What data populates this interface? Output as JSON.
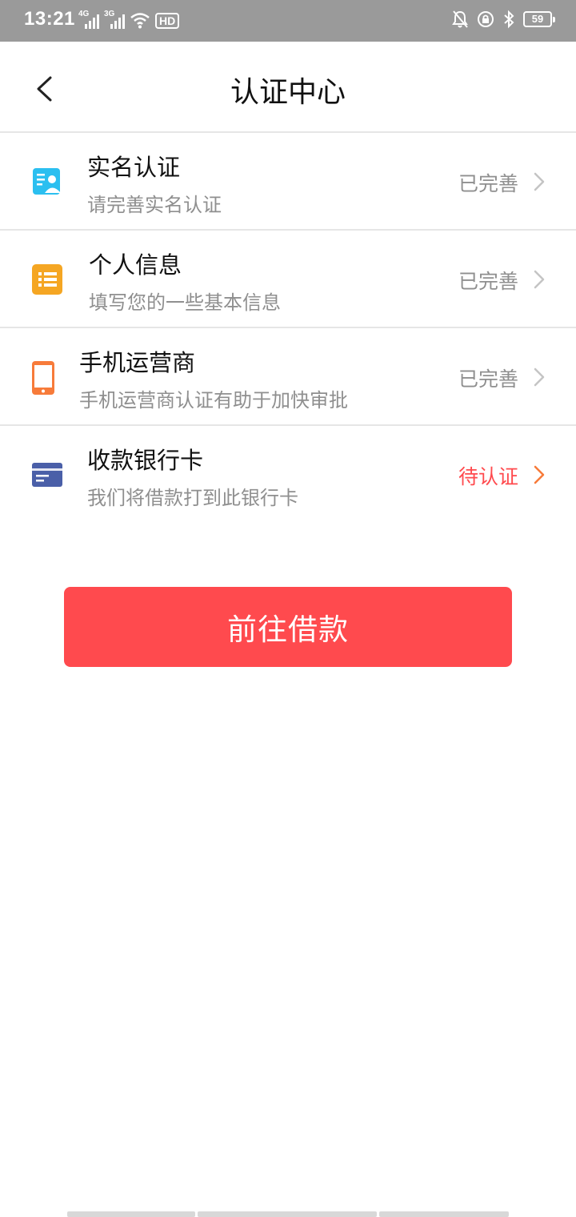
{
  "status_bar": {
    "time": "13:21",
    "signal1_label": "4G",
    "signal2_label": "3G",
    "hd_label": "HD",
    "battery": "59"
  },
  "header": {
    "title": "认证中心"
  },
  "items": [
    {
      "title": "实名认证",
      "subtitle": "请完善实名认证",
      "status": "已完善",
      "icon": "id-card-icon",
      "icon_color": "#2bbff0"
    },
    {
      "title": "个人信息",
      "subtitle": "填写您的一些基本信息",
      "status": "已完善",
      "icon": "list-icon",
      "icon_color": "#f5a623"
    },
    {
      "title": "手机运营商",
      "subtitle": "手机运营商认证有助于加快审批",
      "status": "已完善",
      "icon": "phone-icon",
      "icon_color": "#f77b3a"
    },
    {
      "title": "收款银行卡",
      "subtitle": "我们将借款打到此银行卡",
      "status": "待认证",
      "icon": "bank-card-icon",
      "icon_color": "#4a5fa8"
    }
  ],
  "colors": {
    "accent": "#ff4a4e",
    "status_done": "#8f8f8f",
    "pending_chevron": "#f77b3a"
  },
  "button": {
    "label": "前往借款"
  }
}
